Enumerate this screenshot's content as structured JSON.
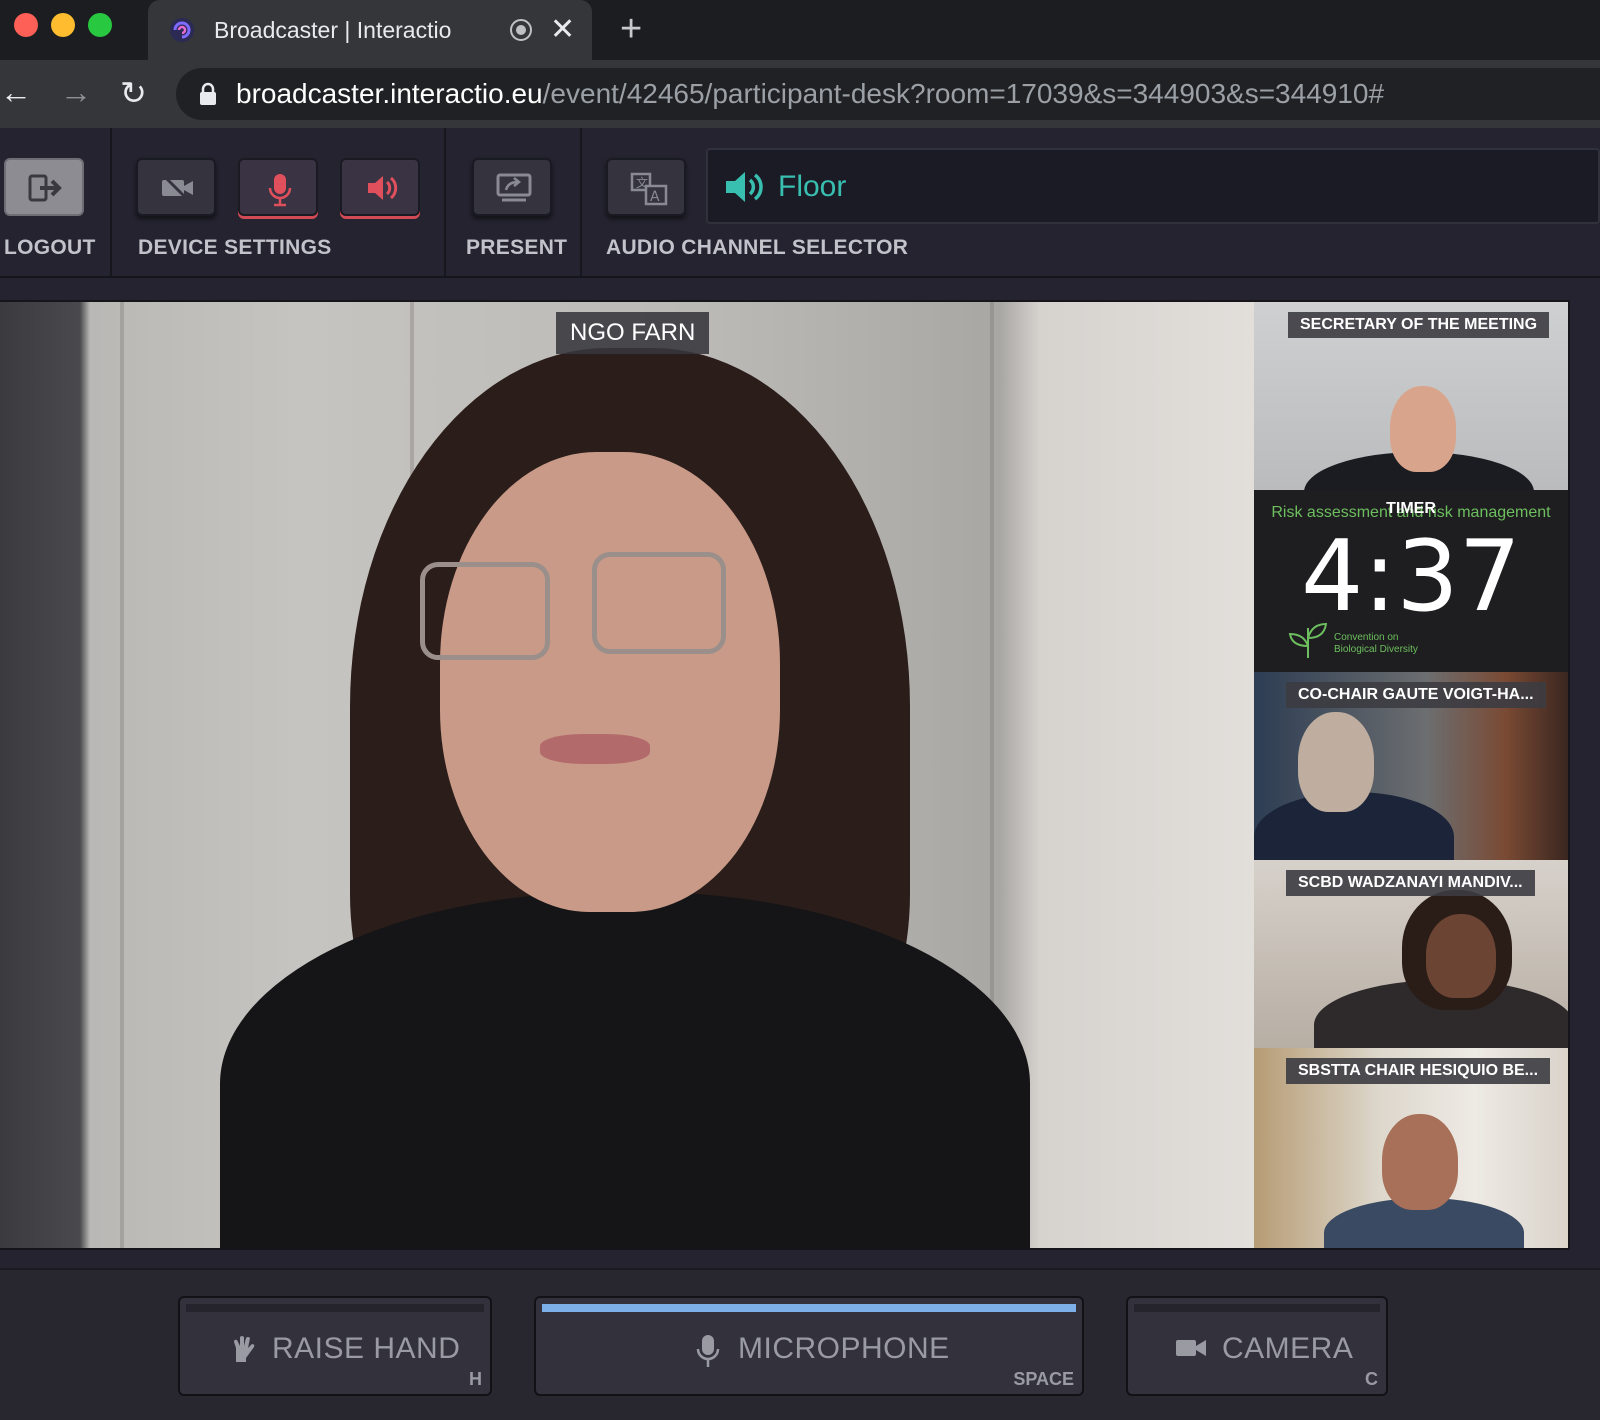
{
  "browser": {
    "tab_title": "Broadcaster | Interactio",
    "url_host": "broadcaster.interactio.eu",
    "url_path": "/event/42465/participant-desk?room=17039&s=344903&s=344910#"
  },
  "toolbar": {
    "logout_label": "LOGOUT",
    "device_settings_label": "DEVICE SETTINGS",
    "present_label": "PRESENT",
    "audio_channel_label": "AUDIO CHANNEL SELECTOR",
    "channel_name": "Floor"
  },
  "main_video": {
    "speaker_name": "NGO FARN"
  },
  "sidebar": {
    "tiles": [
      {
        "name": "SECRETARY OF THE MEETING"
      },
      {
        "name": "TIMER",
        "subtitle": "Risk assessment and risk management",
        "timer_value": "4:37",
        "logo_text": "Convention on\nBiological Diversity"
      },
      {
        "name": "CO-CHAIR GAUTE VOIGT-HA..."
      },
      {
        "name": "SCBD WADZANAYI MANDIV..."
      },
      {
        "name": "SBSTTA CHAIR HESIQUIO BE..."
      }
    ]
  },
  "actions": {
    "raise_hand": {
      "label": "RAISE HAND",
      "shortcut": "H"
    },
    "microphone": {
      "label": "MICROPHONE",
      "shortcut": "SPACE"
    },
    "camera": {
      "label": "CAMERA",
      "shortcut": "C"
    }
  },
  "colors": {
    "accent_teal": "#38bfb0",
    "mic_active": "#7db0e8",
    "alert_red": "#d24a56"
  }
}
